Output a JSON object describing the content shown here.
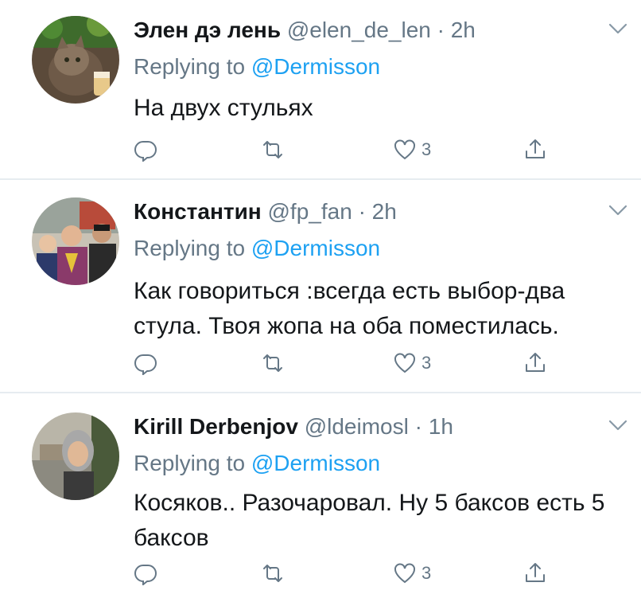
{
  "tweets": [
    {
      "name": "Элен дэ лень",
      "handle": "@elen_de_len",
      "separator": "·",
      "time": "2h",
      "replying_prefix": "Replying to",
      "replying_to": "@Dermisson",
      "text": "На двух стульях",
      "likes": "3"
    },
    {
      "name": "Константин",
      "handle": "@fp_fan",
      "separator": "·",
      "time": "2h",
      "replying_prefix": "Replying to",
      "replying_to": "@Dermisson",
      "text": "Как говориться :всегда есть выбор-два стула. Твоя жопа на оба поместилась.",
      "likes": "3"
    },
    {
      "name": "Kirill Derbenjov",
      "handle": "@ldeimosl",
      "separator": "·",
      "time": "1h",
      "replying_prefix": "Replying to",
      "replying_to": "@Dermisson",
      "text": "Косяков.. Разочаровал. Ну 5 баксов есть 5 баксов",
      "likes": "3"
    }
  ],
  "icons": {
    "reply": "reply-icon",
    "retweet": "retweet-icon",
    "like": "heart-icon",
    "share": "share-icon",
    "menu": "chevron-down-icon"
  },
  "colors": {
    "text": "#14171a",
    "secondary": "#657786",
    "link": "#1da1f2",
    "divider": "#e6ecf0"
  }
}
